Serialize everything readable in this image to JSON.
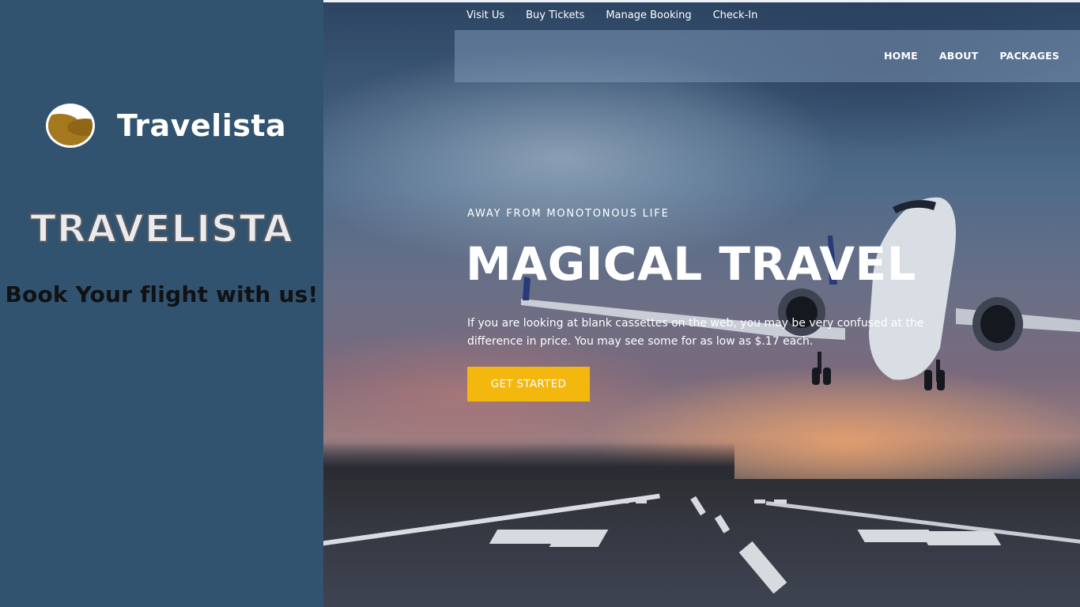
{
  "promo": {
    "logo_text": "Travelista",
    "outline_title": "TRAVELISTA",
    "tagline": "Book Your flight with us!"
  },
  "site": {
    "top_links": [
      "Visit Us",
      "Buy Tickets",
      "Manage Booking",
      "Check-In"
    ],
    "main_nav": [
      "HOME",
      "ABOUT",
      "PACKAGES"
    ],
    "hero": {
      "eyebrow": "AWAY FROM MONOTONOUS LIFE",
      "title": "MAGICAL TRAVEL",
      "description": "If you are looking at blank cassettes on the web, you may be very confused at the difference in price. You may see some for as low as $.17 each.",
      "cta": "GET STARTED"
    }
  },
  "colors": {
    "left_panel_bg": "#31536f",
    "cta_bg": "#f4b70e",
    "logo_sand": "#a4781e"
  },
  "icons": {
    "logo": "sun-over-dunes-logo-icon",
    "hero_image": "airplane-over-runway"
  }
}
